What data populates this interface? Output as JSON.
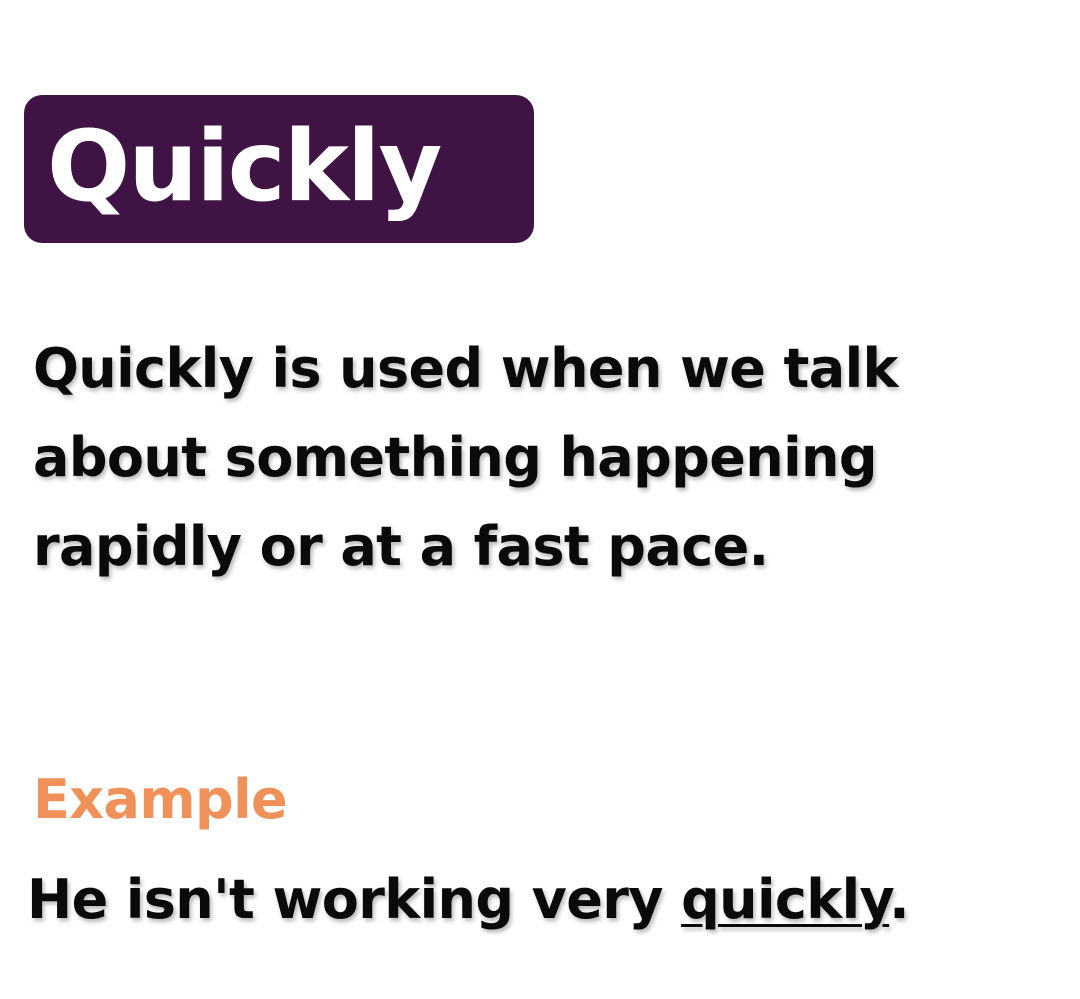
{
  "title": {
    "word": "Quickly",
    "badge_color": "#3f1444",
    "text_color": "#ffffff"
  },
  "definition": {
    "text": "Quickly is used when we talk about something happening rapidly or at a fast pace."
  },
  "example": {
    "label": "Example",
    "label_color": "#f0915a",
    "sentence_before": "He isn't working very ",
    "highlighted_word": "quickly",
    "sentence_after": "."
  }
}
